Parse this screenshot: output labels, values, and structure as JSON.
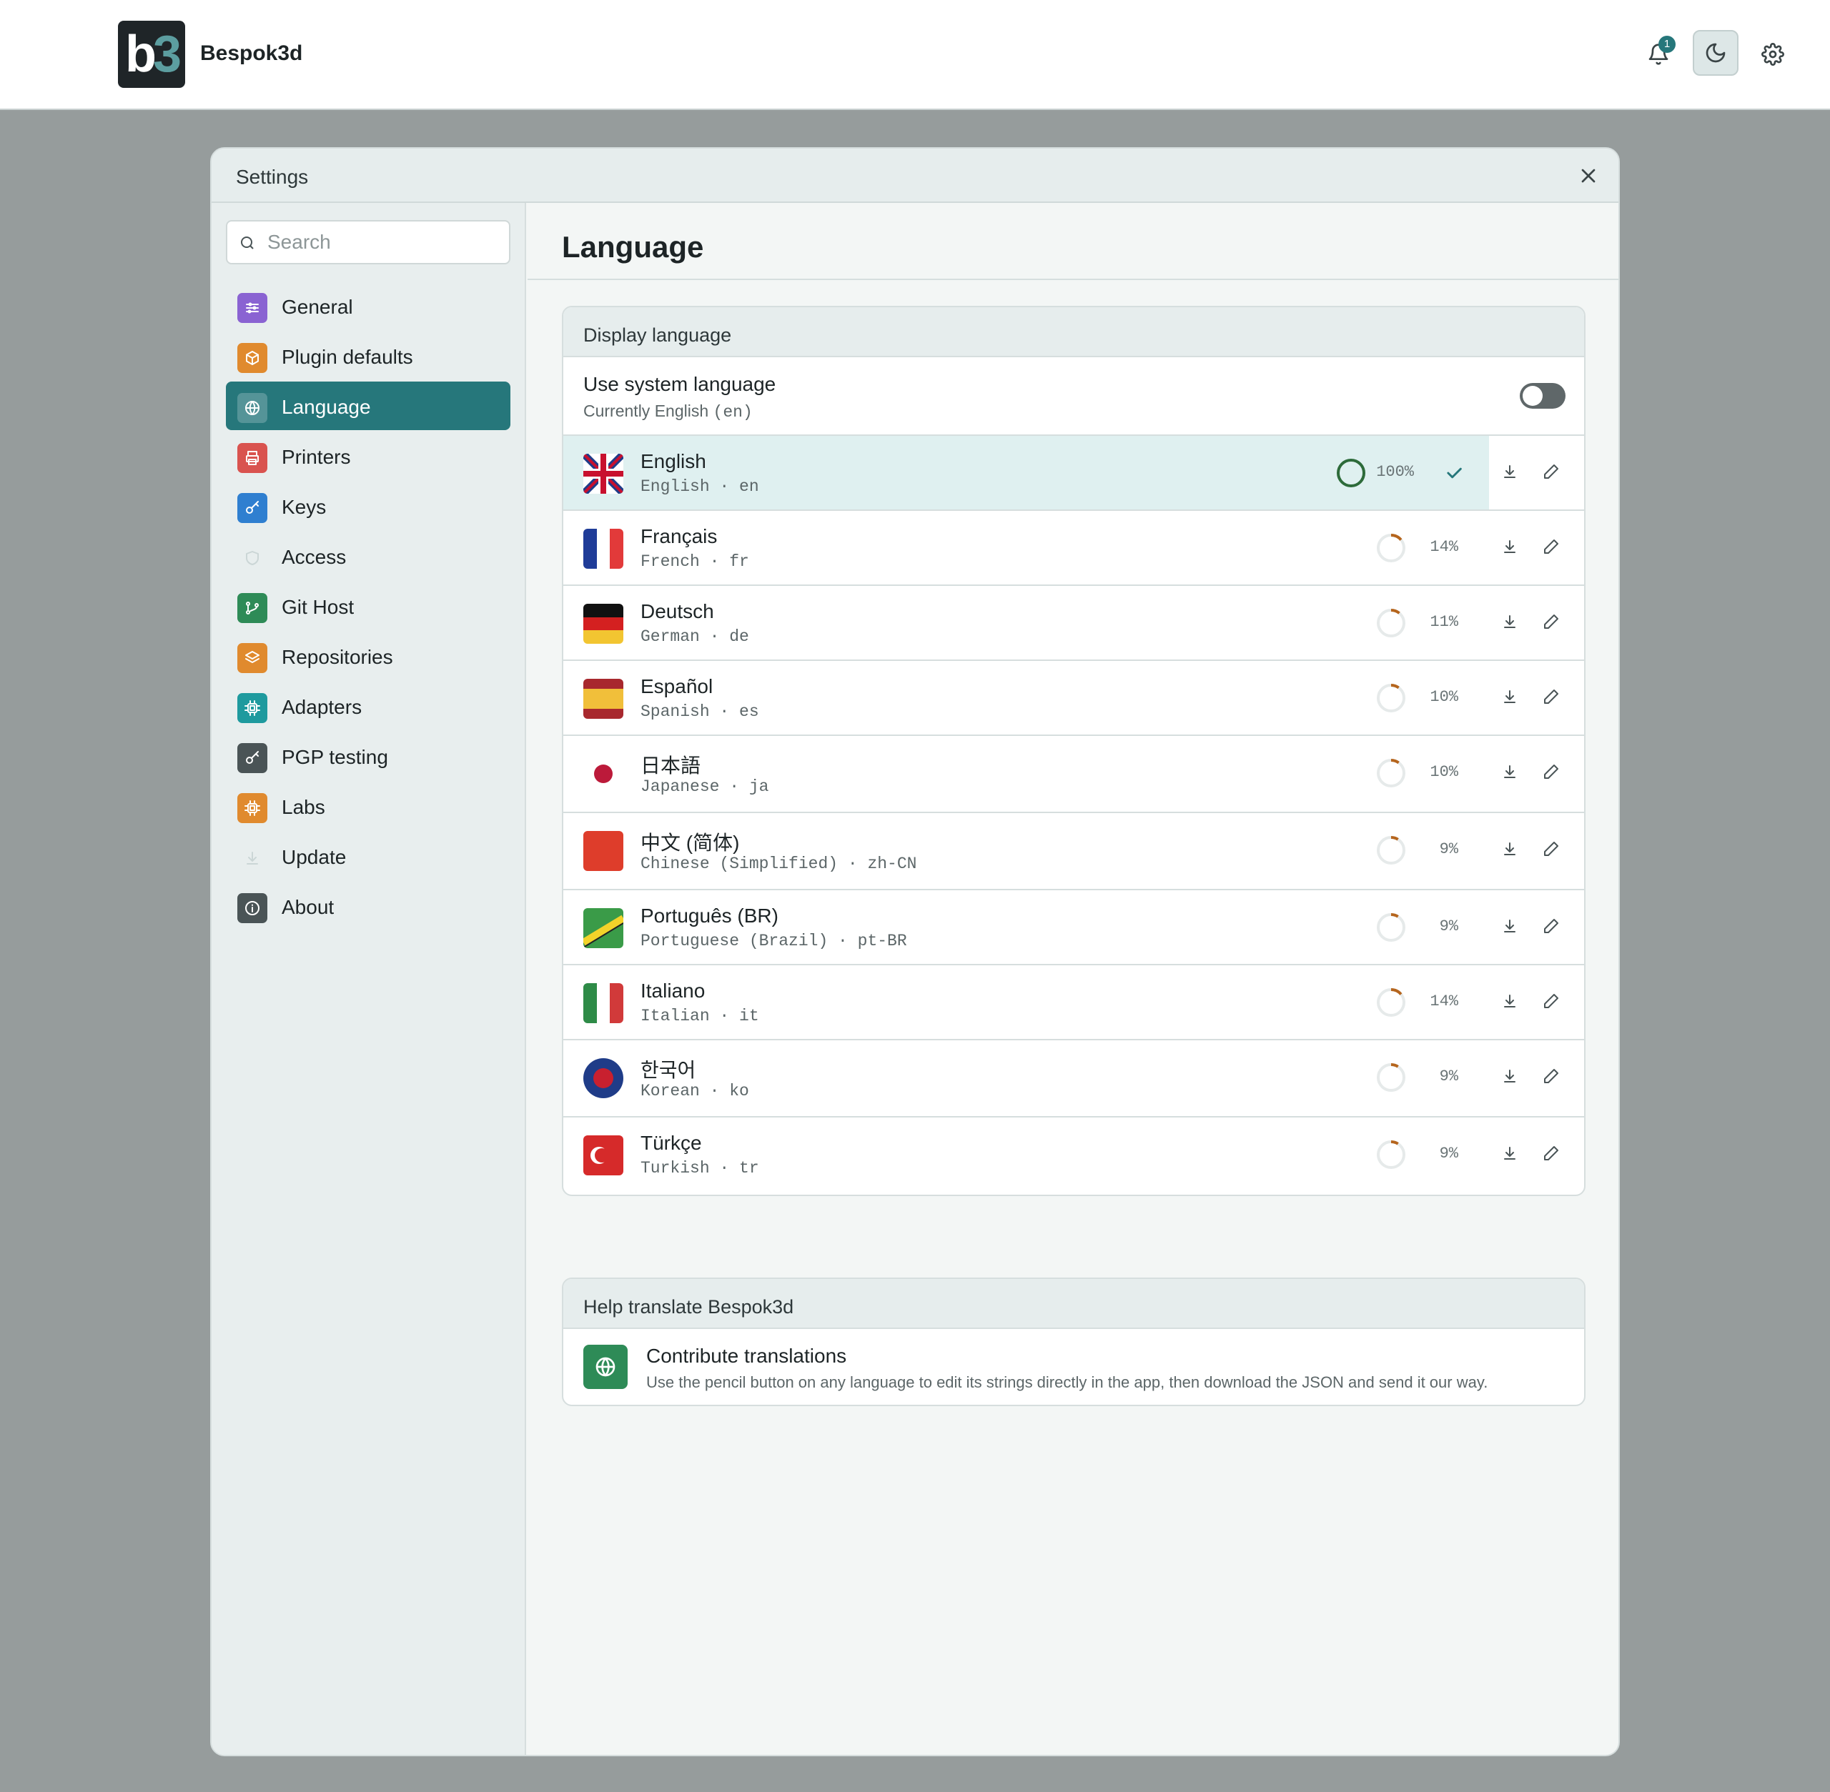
{
  "app": {
    "logo_b": "b",
    "logo_3": "3",
    "name": "Bespok3d",
    "notification_count": "1"
  },
  "modal": {
    "title": "Settings"
  },
  "search": {
    "placeholder": "Search"
  },
  "sidebar": {
    "items": [
      {
        "label": "General",
        "icon": "sliders-icon",
        "color": "#8a63d2"
      },
      {
        "label": "Plugin defaults",
        "icon": "cube-icon",
        "color": "#e08a2e"
      },
      {
        "label": "Language",
        "icon": "globe-icon",
        "color": "#4a9092",
        "active": true
      },
      {
        "label": "Printers",
        "icon": "printer-icon",
        "color": "#d9534f"
      },
      {
        "label": "Keys",
        "icon": "key-icon",
        "color": "#2f7fd0"
      },
      {
        "label": "Access",
        "icon": "shield-icon",
        "color": "#e8eeee"
      },
      {
        "label": "Git Host",
        "icon": "git-branch-icon",
        "color": "#2e8b57"
      },
      {
        "label": "Repositories",
        "icon": "layers-icon",
        "color": "#e08a2e"
      },
      {
        "label": "Adapters",
        "icon": "chip-icon",
        "color": "#1e9a9e"
      },
      {
        "label": "PGP testing",
        "icon": "key-icon",
        "color": "#4a5456"
      },
      {
        "label": "Labs",
        "icon": "chip-icon",
        "color": "#e08a2e"
      },
      {
        "label": "Update",
        "icon": "download-icon",
        "color": "#e8eeee"
      },
      {
        "label": "About",
        "icon": "info-icon",
        "color": "#4a5456"
      }
    ]
  },
  "content": {
    "title": "Language",
    "display_section": "Display language",
    "system_lang_title": "Use system language",
    "system_lang_sub_prefix": "Currently English",
    "system_lang_code": "(en)",
    "system_lang_enabled": false,
    "languages": [
      {
        "name": "English",
        "sub": "English · en",
        "percent": "100%",
        "progress": 1.0,
        "current": true,
        "flag": "uk"
      },
      {
        "name": "Français",
        "sub": "French · fr",
        "percent": "14%",
        "progress": 0.14,
        "flag": "fr"
      },
      {
        "name": "Deutsch",
        "sub": "German · de",
        "percent": "11%",
        "progress": 0.11,
        "flag": "de"
      },
      {
        "name": "Español",
        "sub": "Spanish · es",
        "percent": "10%",
        "progress": 0.1,
        "flag": "es"
      },
      {
        "name": "日本語",
        "sub": "Japanese · ja",
        "percent": "10%",
        "progress": 0.1,
        "flag": "ja"
      },
      {
        "name": "中文 (简体)",
        "sub": "Chinese (Simplified) · zh-CN",
        "percent": "9%",
        "progress": 0.09,
        "flag": "cn"
      },
      {
        "name": "Português (BR)",
        "sub": "Portuguese (Brazil) · pt-BR",
        "percent": "9%",
        "progress": 0.09,
        "flag": "br"
      },
      {
        "name": "Italiano",
        "sub": "Italian · it",
        "percent": "14%",
        "progress": 0.14,
        "flag": "it"
      },
      {
        "name": "한국어",
        "sub": "Korean · ko",
        "percent": "9%",
        "progress": 0.09,
        "flag": "ko"
      },
      {
        "name": "Türkçe",
        "sub": "Turkish · tr",
        "percent": "9%",
        "progress": 0.09,
        "flag": "tr"
      }
    ],
    "help_section": "Help translate Bespok3d",
    "help_title": "Contribute translations",
    "help_sub": "Use the pencil button on any language to edit its strings directly in the app, then download the JSON and send it our way."
  },
  "colors": {
    "accent": "#26777b",
    "progress_partial": "#b5651d",
    "progress_full": "#2d6b3a"
  }
}
